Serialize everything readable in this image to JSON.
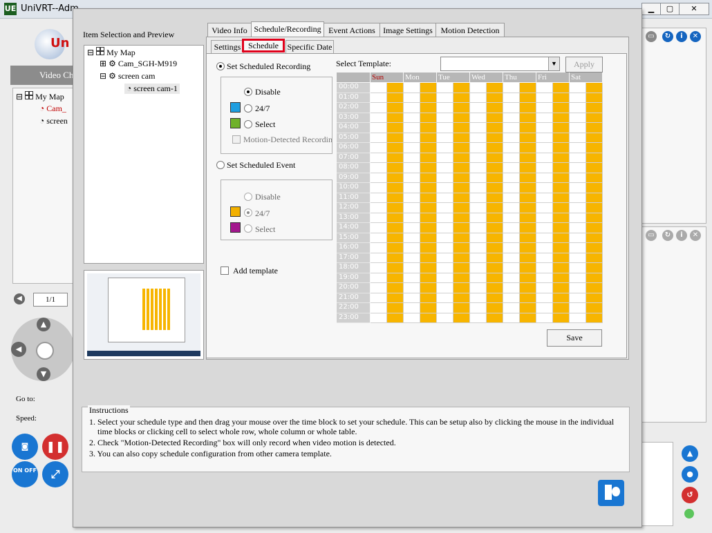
{
  "app": {
    "title": "UniVRT--Adm",
    "icon": "UE",
    "logo_text": "Un",
    "video_ch_label": "Video Ch",
    "page_label": "1/1",
    "goto_label": "Go to:",
    "speed_label": "Speed:",
    "left_tree": {
      "root": "My Map",
      "item1": "Cam_",
      "item2": "screen"
    },
    "onoff_label": "ON OFF"
  },
  "dialog": {
    "item_selection_title": "Item Selection and Preview",
    "tree": {
      "root": "My Map",
      "cam1": "Cam_SGH-M919",
      "group": "screen cam",
      "cam2": "screen cam-1"
    },
    "tabs": [
      "Video Info",
      "Schedule/Recording",
      "Event Actions",
      "Image Settings",
      "Motion Detection"
    ],
    "active_tab": "Schedule/Recording",
    "subtabs": [
      "Settings",
      "Schedule",
      "Specific Date"
    ],
    "active_subtab": "Schedule",
    "recording": {
      "label": "Set Scheduled Recording",
      "disable": "Disable",
      "always": "24/7",
      "select": "Select",
      "motion": "Motion-Detected Recording",
      "always_color": "#1e9ee0",
      "select_color": "#6fb12b"
    },
    "event": {
      "label": "Set Scheduled Event",
      "disable": "Disable",
      "always": "24/7",
      "select": "Select",
      "always_color": "#f2b000",
      "select_color": "#a3178e"
    },
    "add_template": "Add template",
    "template_label": "Select Template:",
    "template_value": "",
    "apply": "Apply",
    "save": "Save",
    "schedule": {
      "days": [
        "Sun",
        "Mon",
        "Tue",
        "Wed",
        "Thu",
        "Fri",
        "Sat"
      ],
      "times": [
        "00:00",
        "01:00",
        "02:00",
        "03:00",
        "04:00",
        "05:00",
        "06:00",
        "07:00",
        "08:00",
        "09:00",
        "10:00",
        "11:00",
        "12:00",
        "13:00",
        "14:00",
        "15:00",
        "16:00",
        "17:00",
        "18:00",
        "19:00",
        "20:00",
        "21:00",
        "22:00",
        "23:00"
      ],
      "filled_color": "#f7b500",
      "sunday_color": "#b00000"
    },
    "instructions": {
      "title": "Instructions",
      "line1": "1. Select your schedule type and then drag your mouse over the time block to set your schedule. This can be setup also by clicking the mouse in the individual",
      "line1b": "time blocks or clicking cell to select whole row, whole column or whole table.",
      "line2": "2.  Check \"Motion-Detected Recording\" box will only record when video motion is detected.",
      "line3": "3. You can also copy schedule configuration from other camera template."
    }
  }
}
